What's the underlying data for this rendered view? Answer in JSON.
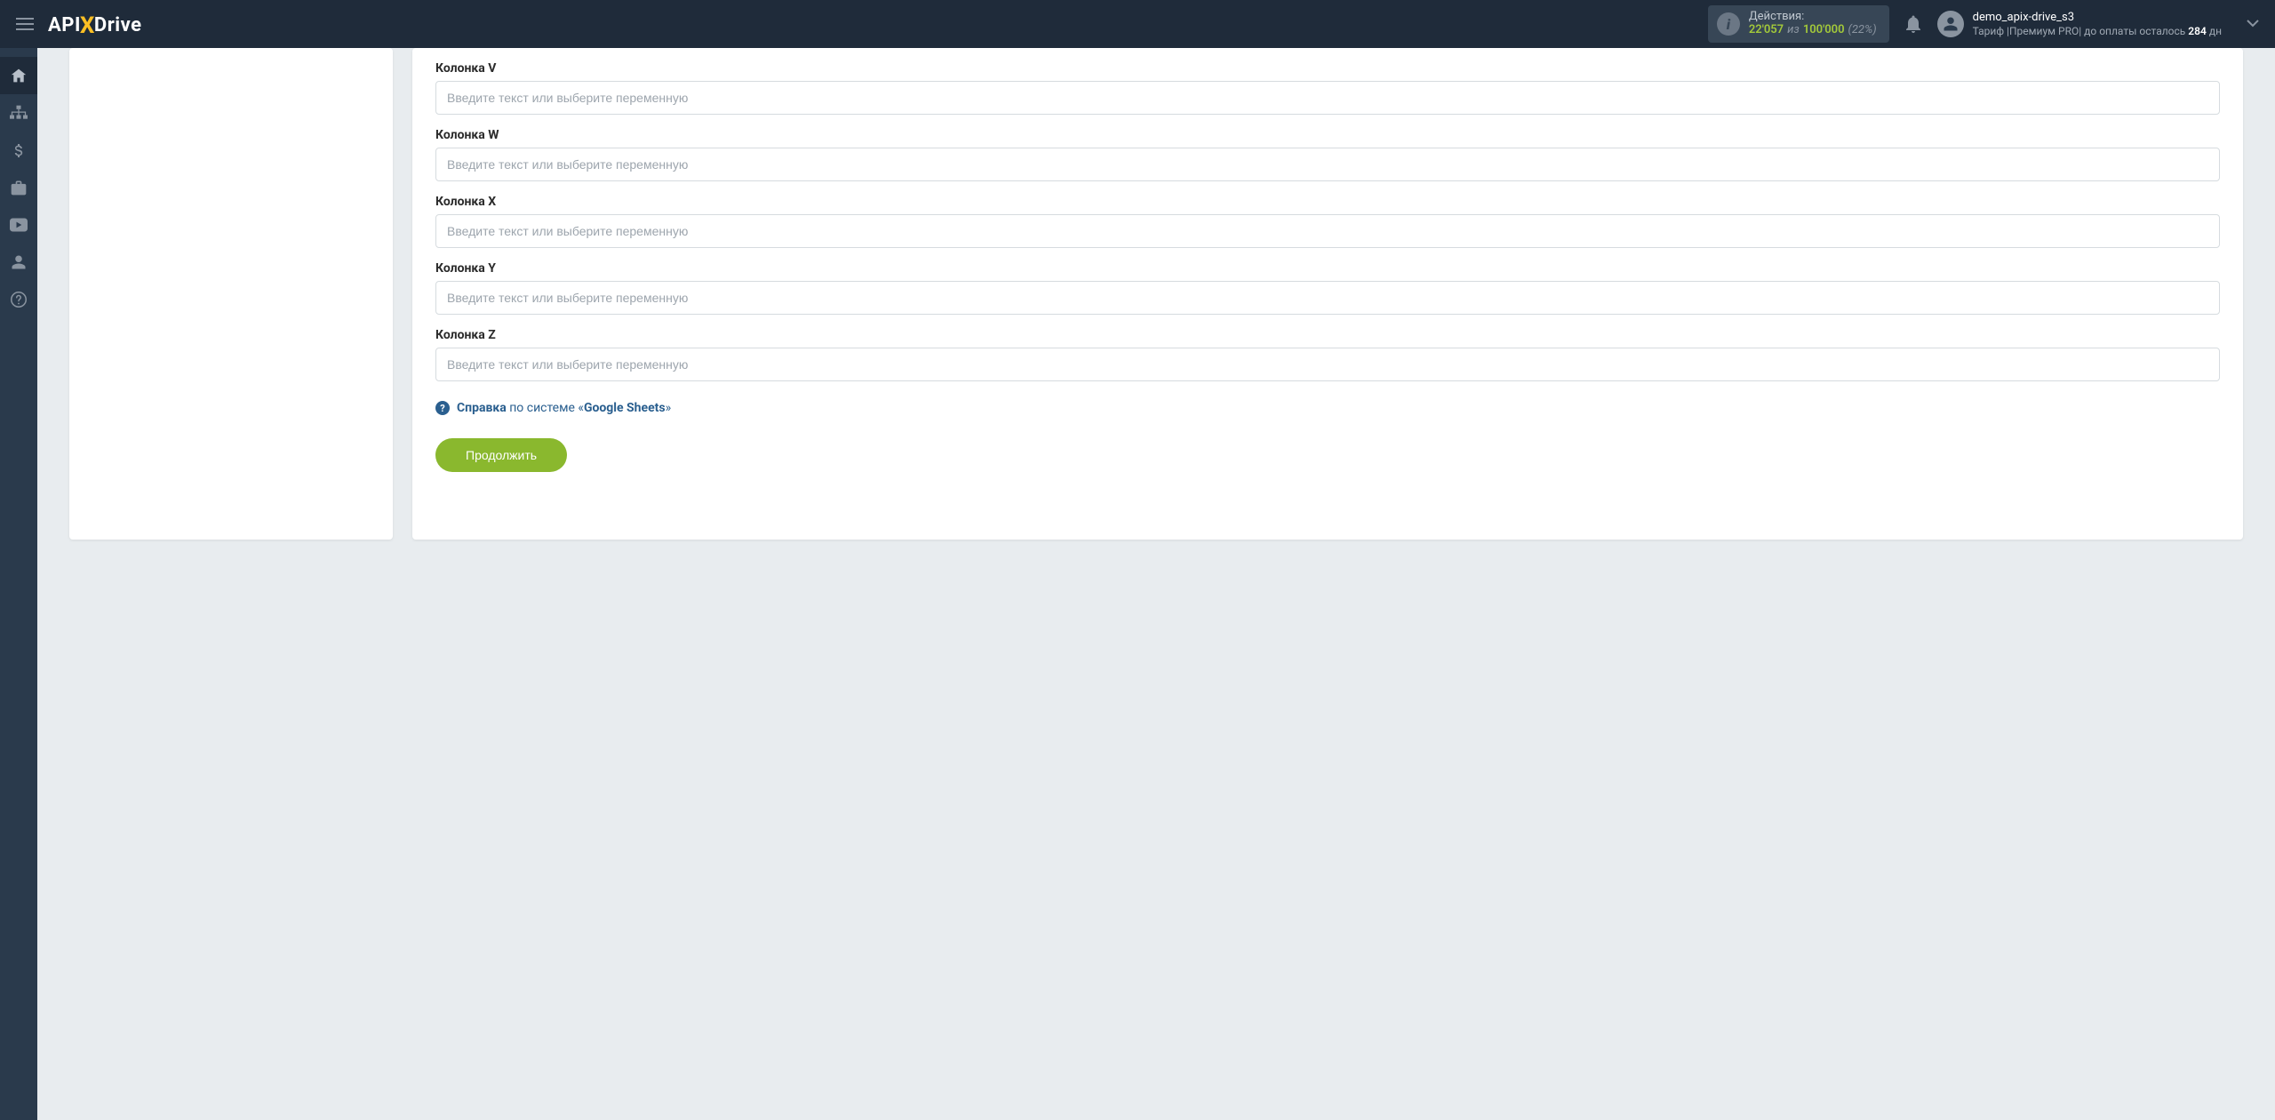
{
  "header": {
    "logo": {
      "part1": "API",
      "part2": "X",
      "part3": "Drive"
    },
    "actions": {
      "label": "Действия:",
      "current": "22'057",
      "of": "из",
      "total": "100'000",
      "percent": "(22%)"
    },
    "user": {
      "name": "demo_apix-drive_s3",
      "tariff_prefix": "Тариф |",
      "tariff_name": "Премиум PRO",
      "tariff_suffix": "| до оплаты осталось ",
      "days": "284",
      "days_unit": " дн"
    }
  },
  "form": {
    "placeholder": "Введите текст или выберите переменную",
    "fields": [
      {
        "label": "Колонка V"
      },
      {
        "label": "Колонка W"
      },
      {
        "label": "Колонка X"
      },
      {
        "label": "Колонка Y"
      },
      {
        "label": "Колонка Z"
      }
    ],
    "help": {
      "word": "Справка",
      "middle": " по системе «",
      "system": "Google Sheets",
      "end": "»"
    },
    "continue": "Продолжить"
  }
}
